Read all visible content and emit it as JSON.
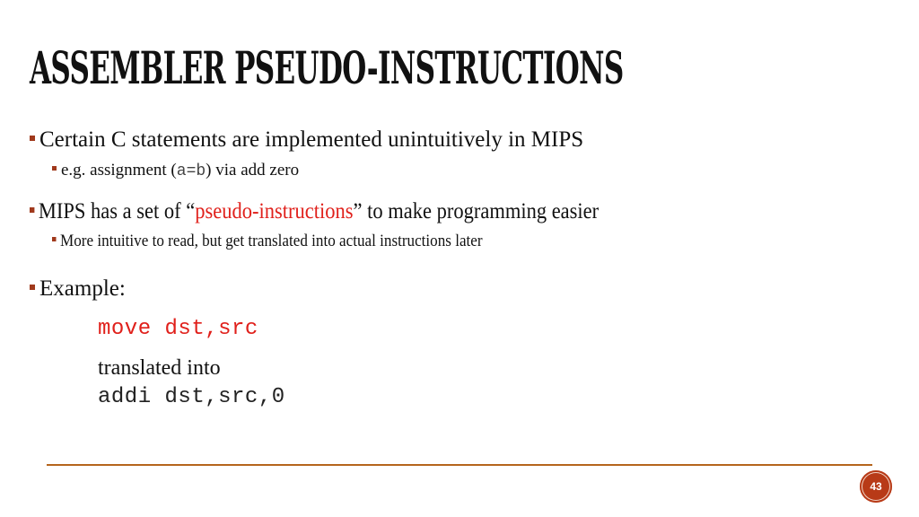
{
  "slide": {
    "title": "ASSEMBLER PSEUDO-INSTRUCTIONS",
    "bullets": [
      {
        "text": "Certain C statements are implemented unintuitively in MIPS",
        "sub": {
          "prefix": "e.g. assignment (",
          "code": "a=b",
          "suffix": ") via add zero"
        }
      },
      {
        "prefix": "MIPS has a set of “",
        "highlight": "pseudo-instructions",
        "suffix": "” to make programming easier",
        "sub": {
          "text": "More intuitive to read, but get translated into actual instructions later"
        }
      },
      {
        "text": "Example:"
      }
    ],
    "example": {
      "pseudo_code": "move dst,src",
      "translated_label": "translated into",
      "real_code": "addi dst,src,0"
    },
    "page_number": "43",
    "colors": {
      "accent": "#a0391c",
      "highlight": "#e0201b",
      "rule": "#b5651d",
      "page_badge": "#b83a17"
    }
  }
}
